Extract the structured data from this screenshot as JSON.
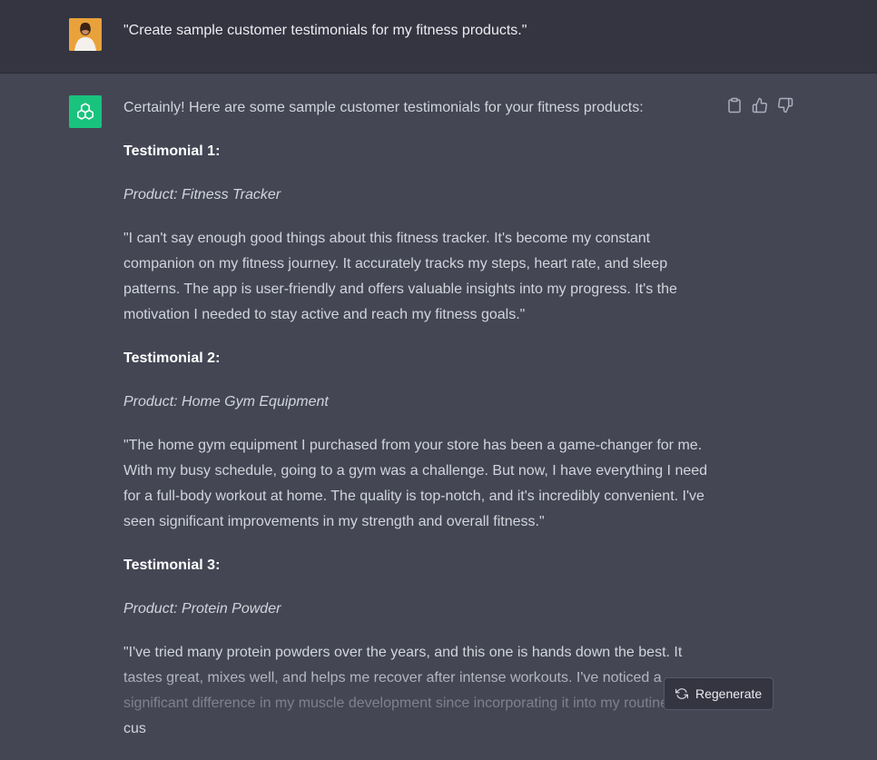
{
  "user_message": {
    "text": "\"Create sample customer testimonials for my fitness products.\""
  },
  "assistant_message": {
    "intro": "Certainly! Here are some sample customer testimonials for your fitness products:",
    "testimonials": [
      {
        "heading": "Testimonial 1:",
        "product": "Product: Fitness Tracker",
        "quote": "\"I can't say enough good things about this fitness tracker. It's become my constant companion on my fitness journey. It accurately tracks my steps, heart rate, and sleep patterns. The app is user-friendly and offers valuable insights into my progress. It's the motivation I needed to stay active and reach my fitness goals.\""
      },
      {
        "heading": "Testimonial 2:",
        "product": "Product: Home Gym Equipment",
        "quote": "\"The home gym equipment I purchased from your store has been a game-changer for me. With my busy schedule, going to a gym was a challenge. But now, I have everything I need for a full-body workout at home. The quality is top-notch, and it's incredibly convenient. I've seen significant improvements in my strength and overall fitness.\""
      },
      {
        "heading": "Testimonial 3:",
        "product": "Product: Protein Powder",
        "quote": "\"I've tried many protein powders over the years, and this one is hands down the best. It tastes great, mixes well, and helps me recover after intense workouts. I've noticed a significant difference in my muscle development since incorporating it into my routine. I'm a cus"
      }
    ]
  },
  "actions": {
    "copy_icon": "clipboard-icon",
    "like_icon": "thumbs-up-icon",
    "dislike_icon": "thumbs-down-icon"
  },
  "regenerate": {
    "label": "Regenerate",
    "icon": "refresh-icon"
  },
  "colors": {
    "user_bg": "#343541",
    "assistant_bg": "#444654",
    "gpt_green": "#19c37d"
  }
}
